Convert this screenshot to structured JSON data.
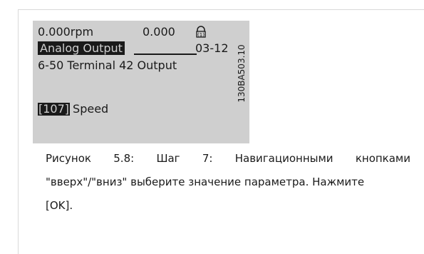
{
  "lcd": {
    "line1": {
      "rpm": "0.000rpm",
      "value": "0.000",
      "icon": "lock-icon"
    },
    "line2": {
      "label": "Analog Output",
      "number": "03-12"
    },
    "line3": "6-50 Terminal 42 Output",
    "line5": {
      "selection": "[107]",
      "text": "Speed"
    }
  },
  "figure_code": "130BA503.10",
  "caption": {
    "line1": "Рисунок 5.8: Шаг 7: Навигационными кнопками",
    "line2": "\"вверх\"/\"вниз\" выберите значение параметра. Нажмите",
    "line3": "[OK]."
  }
}
